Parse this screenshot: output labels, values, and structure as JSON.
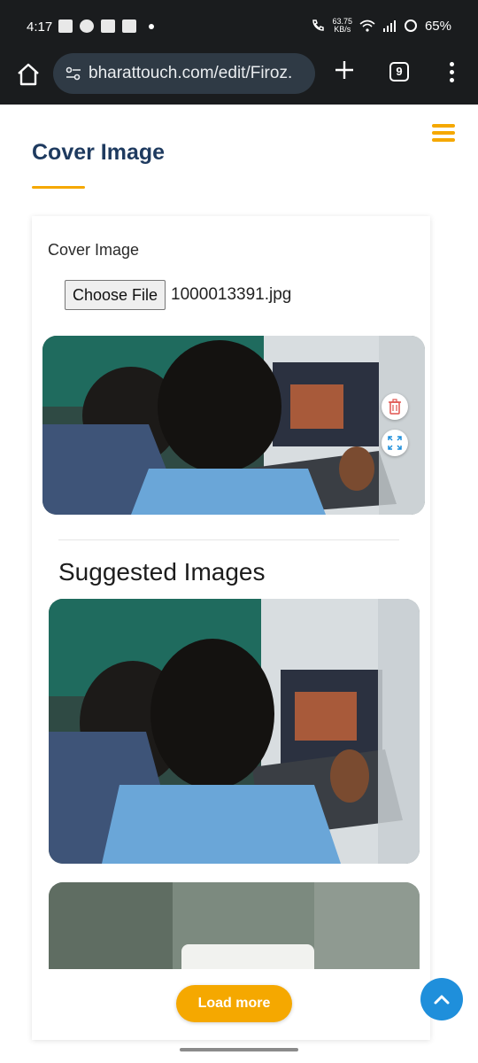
{
  "status_bar": {
    "time": "4:17",
    "net_speed_value": "63.75",
    "net_speed_unit": "KB/s",
    "battery": "65%"
  },
  "browser": {
    "url": "bharattouch.com/edit/Firoz.",
    "tab_count": "9"
  },
  "page": {
    "title": "Cover Image",
    "accent_color": "#f5a800",
    "title_color": "#1e3a5f"
  },
  "cover_field": {
    "label": "Cover Image",
    "choose_button": "Choose File",
    "file_name": "1000013391.jpg"
  },
  "suggested": {
    "title": "Suggested Images"
  },
  "actions": {
    "load_more": "Load more"
  },
  "icons": {
    "home": "home-icon",
    "site_settings": "tune-icon",
    "new_tab": "plus-icon",
    "tabs": "tab-count-icon",
    "menu": "more-vert-icon",
    "hamburger": "hamburger-menu-icon",
    "delete": "trash-icon",
    "expand": "expand-icon",
    "scroll_top": "chevron-up-icon"
  }
}
